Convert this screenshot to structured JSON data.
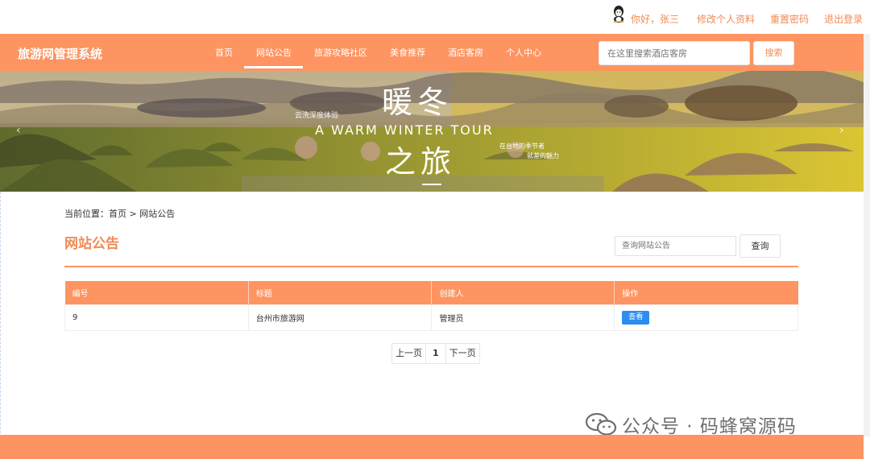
{
  "topbar": {
    "greeting": "你好，张三",
    "edit_profile": "修改个人资料",
    "reset_password": "重置密码",
    "logout": "退出登录"
  },
  "navbar": {
    "brand": "旅游网管理系统",
    "items": [
      {
        "label": "首页"
      },
      {
        "label": "网站公告"
      },
      {
        "label": "旅游攻略社区"
      },
      {
        "label": "美食推荐"
      },
      {
        "label": "酒店客房"
      },
      {
        "label": "个人中心"
      }
    ],
    "active_index": 1,
    "search_placeholder": "在这里搜索酒店客房",
    "search_button": "搜索"
  },
  "banner": {
    "title_top": "暖冬",
    "title_bottom": "之旅",
    "subtitle": "A WARM WINTER TOUR",
    "caption_left": "云洗深度体验",
    "caption_right_1": "在台地的季节者",
    "caption_right_2": "就差的魅力"
  },
  "breadcrumb": "当前位置：首页 > 网站公告",
  "page_title": "网站公告",
  "query": {
    "placeholder": "查询网站公告",
    "button": "查询"
  },
  "table": {
    "headers": [
      "编号",
      "标题",
      "创建人",
      "操作"
    ],
    "rows": [
      {
        "id": "9",
        "title": "台州市旅游网",
        "creator": "管理员",
        "action": "查看"
      }
    ]
  },
  "pager": {
    "prev": "上一页",
    "current": "1",
    "next": "下一页"
  },
  "watermark": "公众号 · 码蜂窝源码",
  "colors": {
    "accent": "#fe9461",
    "accent_text": "#f08a56",
    "button_blue": "#2d8cf0"
  }
}
